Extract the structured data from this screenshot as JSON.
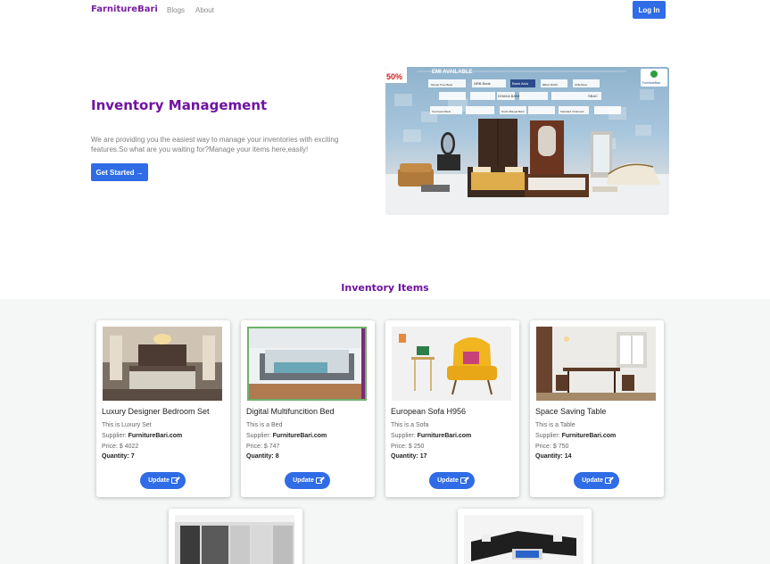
{
  "nav": {
    "brand": "FarnitureBari",
    "links": [
      "Blogs",
      "About"
    ],
    "login_label": "Log In"
  },
  "hero": {
    "title": "Inventory Management",
    "description": "We are providing you the easiest way to manage your inventories with exciting features.So what are you waiting for?Manage your items here,easily!",
    "cta_label": "Get Started",
    "cta_icon": "arrow-right-icon",
    "banner": {
      "badge": "50%",
      "heading": "EMI AVAILABLE",
      "logos": [
        "NRB Bank",
        "Bank Asia",
        "DHAKA BANK",
        "Mutual Trust Bank",
        "BRAC BANK",
        "ONE Bank",
        "SBAC",
        "Southeast Bank",
        "Dutch-Bangla Bank",
        "Standard Chartered"
      ],
      "logo_label": "FurnitureBari"
    }
  },
  "inventory": {
    "section_title": "Inventory Items",
    "update_label": "Update",
    "supplier_prefix": "Supplier:",
    "price_prefix": "Price: $",
    "quantity_prefix": "Quantity:",
    "items": [
      {
        "name": "Luxury Designer Bedroom Set",
        "description": "This is Luxury Set",
        "supplier": "FurnitureBari.com",
        "price": "4022",
        "quantity": "7"
      },
      {
        "name": "Digital Multifuncition Bed",
        "description": "This is a Bed",
        "supplier": "FurnitureBari.com",
        "price": "747",
        "quantity": "8"
      },
      {
        "name": "European Sofa H956",
        "description": "This is a Sofa",
        "supplier": "FurnitureBari.com",
        "price": "250",
        "quantity": "17"
      },
      {
        "name": "Space Saving Table",
        "description": "This is a Table",
        "supplier": "FurnitureBari.com",
        "price": "750",
        "quantity": "14"
      }
    ]
  },
  "colors": {
    "brand": "#7a1fa2",
    "primary_button": "#2f6ce5",
    "section_bg": "#f5f7f7"
  }
}
